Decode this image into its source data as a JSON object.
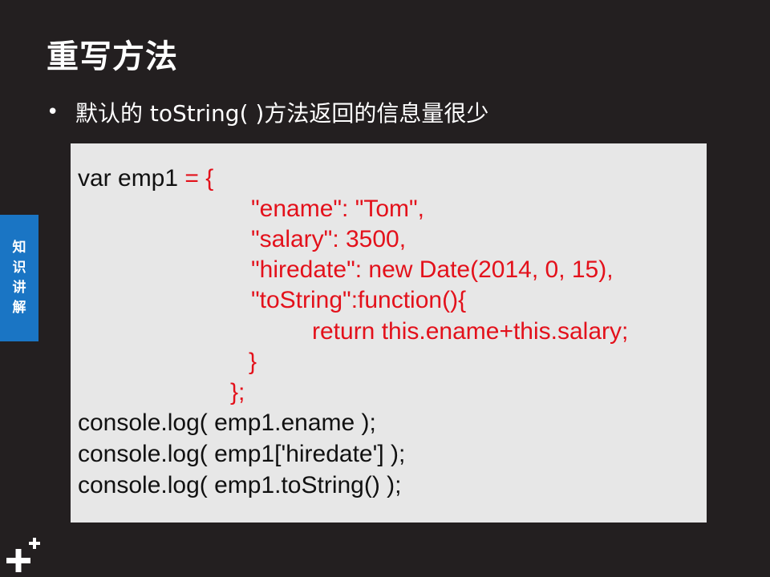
{
  "slide": {
    "title": "重写方法",
    "bullet": "默认的 toString( )方法返回的信息量很少",
    "side_tab": [
      "知",
      "识",
      "讲",
      "解"
    ],
    "code": {
      "line1_black": "var emp1",
      "line1_red": " = {",
      "line2": "\"ename\": \"Tom\",",
      "line3": "\"salary\": 3500,",
      "line4": "\"hiredate\": new Date(2014, 0, 15),",
      "line5": "\"toString\":function(){",
      "line6": "return this.ename+this.salary;",
      "line7": "}",
      "line8": "};",
      "line9": "console.log( emp1.ename );",
      "line10": "console.log( emp1['hiredate'] );",
      "line11": "console.log( emp1.toString() );"
    },
    "colors": {
      "background": "#231f20",
      "code_background": "#e7e7e7",
      "code_highlight": "#e3111b",
      "side_tab": "#1a75c4"
    },
    "logo_icon": "plus-logo-icon"
  }
}
